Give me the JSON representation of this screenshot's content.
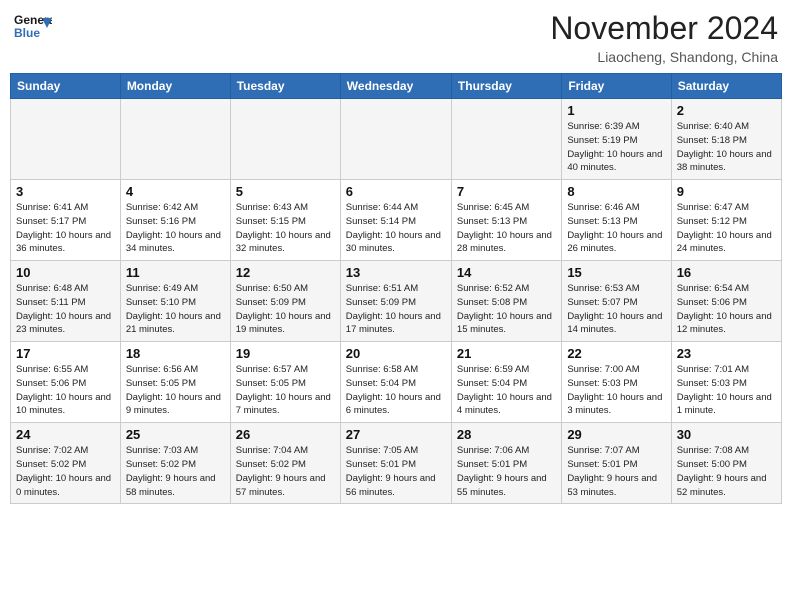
{
  "header": {
    "logo_line1": "General",
    "logo_line2": "Blue",
    "month_year": "November 2024",
    "location": "Liaocheng, Shandong, China"
  },
  "weekdays": [
    "Sunday",
    "Monday",
    "Tuesday",
    "Wednesday",
    "Thursday",
    "Friday",
    "Saturday"
  ],
  "weeks": [
    [
      {
        "day": "",
        "info": ""
      },
      {
        "day": "",
        "info": ""
      },
      {
        "day": "",
        "info": ""
      },
      {
        "day": "",
        "info": ""
      },
      {
        "day": "",
        "info": ""
      },
      {
        "day": "1",
        "info": "Sunrise: 6:39 AM\nSunset: 5:19 PM\nDaylight: 10 hours and 40 minutes."
      },
      {
        "day": "2",
        "info": "Sunrise: 6:40 AM\nSunset: 5:18 PM\nDaylight: 10 hours and 38 minutes."
      }
    ],
    [
      {
        "day": "3",
        "info": "Sunrise: 6:41 AM\nSunset: 5:17 PM\nDaylight: 10 hours and 36 minutes."
      },
      {
        "day": "4",
        "info": "Sunrise: 6:42 AM\nSunset: 5:16 PM\nDaylight: 10 hours and 34 minutes."
      },
      {
        "day": "5",
        "info": "Sunrise: 6:43 AM\nSunset: 5:15 PM\nDaylight: 10 hours and 32 minutes."
      },
      {
        "day": "6",
        "info": "Sunrise: 6:44 AM\nSunset: 5:14 PM\nDaylight: 10 hours and 30 minutes."
      },
      {
        "day": "7",
        "info": "Sunrise: 6:45 AM\nSunset: 5:13 PM\nDaylight: 10 hours and 28 minutes."
      },
      {
        "day": "8",
        "info": "Sunrise: 6:46 AM\nSunset: 5:13 PM\nDaylight: 10 hours and 26 minutes."
      },
      {
        "day": "9",
        "info": "Sunrise: 6:47 AM\nSunset: 5:12 PM\nDaylight: 10 hours and 24 minutes."
      }
    ],
    [
      {
        "day": "10",
        "info": "Sunrise: 6:48 AM\nSunset: 5:11 PM\nDaylight: 10 hours and 23 minutes."
      },
      {
        "day": "11",
        "info": "Sunrise: 6:49 AM\nSunset: 5:10 PM\nDaylight: 10 hours and 21 minutes."
      },
      {
        "day": "12",
        "info": "Sunrise: 6:50 AM\nSunset: 5:09 PM\nDaylight: 10 hours and 19 minutes."
      },
      {
        "day": "13",
        "info": "Sunrise: 6:51 AM\nSunset: 5:09 PM\nDaylight: 10 hours and 17 minutes."
      },
      {
        "day": "14",
        "info": "Sunrise: 6:52 AM\nSunset: 5:08 PM\nDaylight: 10 hours and 15 minutes."
      },
      {
        "day": "15",
        "info": "Sunrise: 6:53 AM\nSunset: 5:07 PM\nDaylight: 10 hours and 14 minutes."
      },
      {
        "day": "16",
        "info": "Sunrise: 6:54 AM\nSunset: 5:06 PM\nDaylight: 10 hours and 12 minutes."
      }
    ],
    [
      {
        "day": "17",
        "info": "Sunrise: 6:55 AM\nSunset: 5:06 PM\nDaylight: 10 hours and 10 minutes."
      },
      {
        "day": "18",
        "info": "Sunrise: 6:56 AM\nSunset: 5:05 PM\nDaylight: 10 hours and 9 minutes."
      },
      {
        "day": "19",
        "info": "Sunrise: 6:57 AM\nSunset: 5:05 PM\nDaylight: 10 hours and 7 minutes."
      },
      {
        "day": "20",
        "info": "Sunrise: 6:58 AM\nSunset: 5:04 PM\nDaylight: 10 hours and 6 minutes."
      },
      {
        "day": "21",
        "info": "Sunrise: 6:59 AM\nSunset: 5:04 PM\nDaylight: 10 hours and 4 minutes."
      },
      {
        "day": "22",
        "info": "Sunrise: 7:00 AM\nSunset: 5:03 PM\nDaylight: 10 hours and 3 minutes."
      },
      {
        "day": "23",
        "info": "Sunrise: 7:01 AM\nSunset: 5:03 PM\nDaylight: 10 hours and 1 minute."
      }
    ],
    [
      {
        "day": "24",
        "info": "Sunrise: 7:02 AM\nSunset: 5:02 PM\nDaylight: 10 hours and 0 minutes."
      },
      {
        "day": "25",
        "info": "Sunrise: 7:03 AM\nSunset: 5:02 PM\nDaylight: 9 hours and 58 minutes."
      },
      {
        "day": "26",
        "info": "Sunrise: 7:04 AM\nSunset: 5:02 PM\nDaylight: 9 hours and 57 minutes."
      },
      {
        "day": "27",
        "info": "Sunrise: 7:05 AM\nSunset: 5:01 PM\nDaylight: 9 hours and 56 minutes."
      },
      {
        "day": "28",
        "info": "Sunrise: 7:06 AM\nSunset: 5:01 PM\nDaylight: 9 hours and 55 minutes."
      },
      {
        "day": "29",
        "info": "Sunrise: 7:07 AM\nSunset: 5:01 PM\nDaylight: 9 hours and 53 minutes."
      },
      {
        "day": "30",
        "info": "Sunrise: 7:08 AM\nSunset: 5:00 PM\nDaylight: 9 hours and 52 minutes."
      }
    ]
  ]
}
